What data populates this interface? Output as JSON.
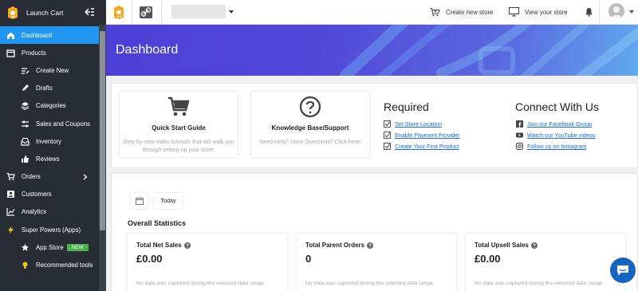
{
  "app": {
    "name": "Launch Cart"
  },
  "sidebar": {
    "items": [
      {
        "label": "Dashboard",
        "icon": "home-icon",
        "active": true
      },
      {
        "label": "Products",
        "icon": "box-icon"
      },
      {
        "label": "Create New",
        "icon": "pencil-lines-icon",
        "sub": true
      },
      {
        "label": "Drafts",
        "icon": "pencil-icon",
        "sub": true
      },
      {
        "label": "Categories",
        "icon": "stack-icon",
        "sub": true
      },
      {
        "label": "Sales and Coupons",
        "icon": "sliders-icon",
        "sub": true
      },
      {
        "label": "Inventory",
        "icon": "inbox-icon",
        "sub": true
      },
      {
        "label": "Reviews",
        "icon": "thumb-up-icon",
        "sub": true
      },
      {
        "label": "Orders",
        "icon": "cart-icon",
        "has_chevron": true
      },
      {
        "label": "Customers",
        "icon": "person-box-icon"
      },
      {
        "label": "Analytics",
        "icon": "chart-icon"
      },
      {
        "label": "Super Powers (Apps)",
        "icon": "lightning-icon"
      },
      {
        "label": "App Store",
        "icon": "star-icon",
        "sub": true,
        "badge": "NEW"
      },
      {
        "label": "Recommended tools",
        "icon": "bulb-icon",
        "sub": true
      }
    ]
  },
  "topbar": {
    "create_store": "Create new store",
    "view_store": "View your store"
  },
  "banner": {
    "title": "Dashboard"
  },
  "quick_cards": [
    {
      "title": "Quick Start Guide",
      "desc": "Step-by-step video tutorials that will walk you through setting up your store.",
      "icon": "cart-icon"
    },
    {
      "title": "Knowledge Base/Support",
      "desc": "Need Help? Have Questions? Click here!",
      "icon": "question-circle-icon"
    }
  ],
  "required": {
    "title": "Required",
    "links": [
      "Set Store Location",
      "Enable Payment Provider",
      "Create Your First Product"
    ]
  },
  "connect": {
    "title": "Connect With Us",
    "links": [
      "Join our Facebook Group",
      "Watch our YouTube videos",
      "Follow us on Instagram"
    ]
  },
  "filters": {
    "today": "Today"
  },
  "stats": {
    "title": "Overall Statistics",
    "cards": [
      {
        "label": "Total Net Sales",
        "value": "£0.00",
        "note": "No data was captured during the selected date range."
      },
      {
        "label": "Total Parent Orders",
        "value": "0",
        "note": "No data was captured during the selected date range."
      },
      {
        "label": "Total Upsell Sales",
        "value": "£0.00",
        "note": "No data was captured during the selected date range."
      }
    ]
  },
  "colors": {
    "accent": "#2196f3",
    "sidebar": "#282c34",
    "link": "#1e6bd6",
    "badge": "#4caf50"
  }
}
